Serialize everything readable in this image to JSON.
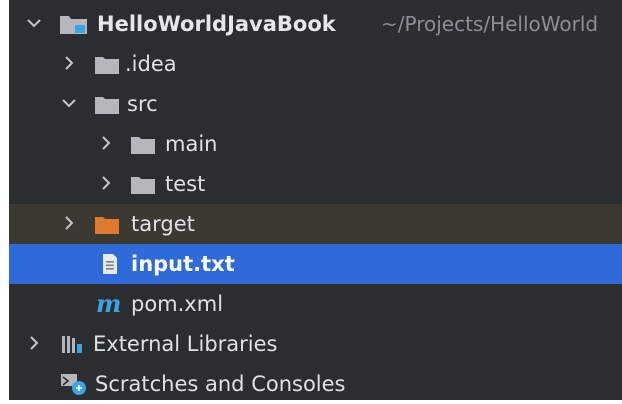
{
  "colors": {
    "panel_bg": "#2b2d30",
    "selection": "#2e6ad8",
    "excluded_row": "#3c3832",
    "folder_gray": "#b4b7bc",
    "folder_orange": "#dd7a2f",
    "module_blue": "#3aa4e4"
  },
  "tree": {
    "root": {
      "label": "HelloWorldJavaBook",
      "path_hint": "~/Projects/HelloWorld",
      "expanded": true,
      "icon": "module-folder-icon"
    },
    "idea": {
      "label": ".idea",
      "expanded": false,
      "icon": "folder-icon"
    },
    "src": {
      "label": "src",
      "expanded": true,
      "icon": "folder-icon"
    },
    "main": {
      "label": "main",
      "expanded": false,
      "icon": "folder-icon"
    },
    "test": {
      "label": "test",
      "expanded": false,
      "icon": "folder-icon"
    },
    "target": {
      "label": "target",
      "expanded": false,
      "icon": "excluded-folder-icon"
    },
    "input": {
      "label": "input.txt",
      "selected": true,
      "icon": "text-file-icon"
    },
    "pom": {
      "label": "pom.xml",
      "icon": "maven-icon"
    },
    "external_libraries": {
      "label": "External Libraries",
      "expanded": false,
      "icon": "library-icon"
    },
    "scratches": {
      "label": "Scratches and Consoles",
      "icon": "scratches-icon"
    }
  }
}
